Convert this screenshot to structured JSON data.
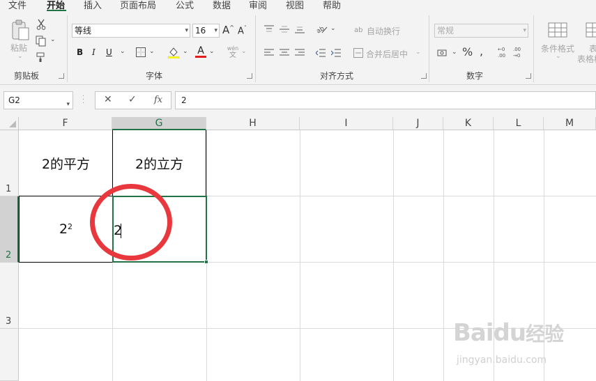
{
  "ribbon_tabs": [
    {
      "label": "文件"
    },
    {
      "label": "开始"
    },
    {
      "label": "插入"
    },
    {
      "label": "页面布局"
    },
    {
      "label": "公式"
    },
    {
      "label": "数据"
    },
    {
      "label": "审阅"
    },
    {
      "label": "视图"
    },
    {
      "label": "帮助"
    }
  ],
  "active_tab": "开始",
  "clipboard": {
    "paste_label": "粘贴",
    "group_label": "剪贴板"
  },
  "font": {
    "name": "等线",
    "size": "16",
    "bold": "B",
    "italic": "I",
    "underline": "U",
    "font_color_icon": "A",
    "grow_icon": "A",
    "shrink_icon": "A",
    "phonetic_top": "wén",
    "phonetic_bottom": "文",
    "group_label": "字体"
  },
  "alignment": {
    "wrap_text": "自动换行",
    "merge_center": "合并后居中",
    "group_label": "对齐方式"
  },
  "number": {
    "format": "常规",
    "percent": "%",
    "group_label": "数字"
  },
  "styles": {
    "conditional_format": "条件格式",
    "table_format_partial": "表",
    "table_format_partial2": "表格格"
  },
  "formula_bar": {
    "name_box": "G2",
    "cancel_icon": "✕",
    "enter_icon": "✓",
    "fx_label": "fx",
    "value": "2"
  },
  "columns": [
    "F",
    "G",
    "H",
    "I",
    "J",
    "K",
    "L",
    "M"
  ],
  "rows": [
    "1",
    "2",
    "3"
  ],
  "cells": {
    "F1": "2的平方",
    "G1": "2的立方",
    "F2_base": "2",
    "F2_exp": "2",
    "G2": "2"
  },
  "watermark": {
    "brand_left": "Bai",
    "brand_right": "du",
    "brand_cn": "经验",
    "url": "jingyan.baidu.com"
  },
  "colors": {
    "accent": "#217346",
    "annotation": "#e8383d"
  }
}
